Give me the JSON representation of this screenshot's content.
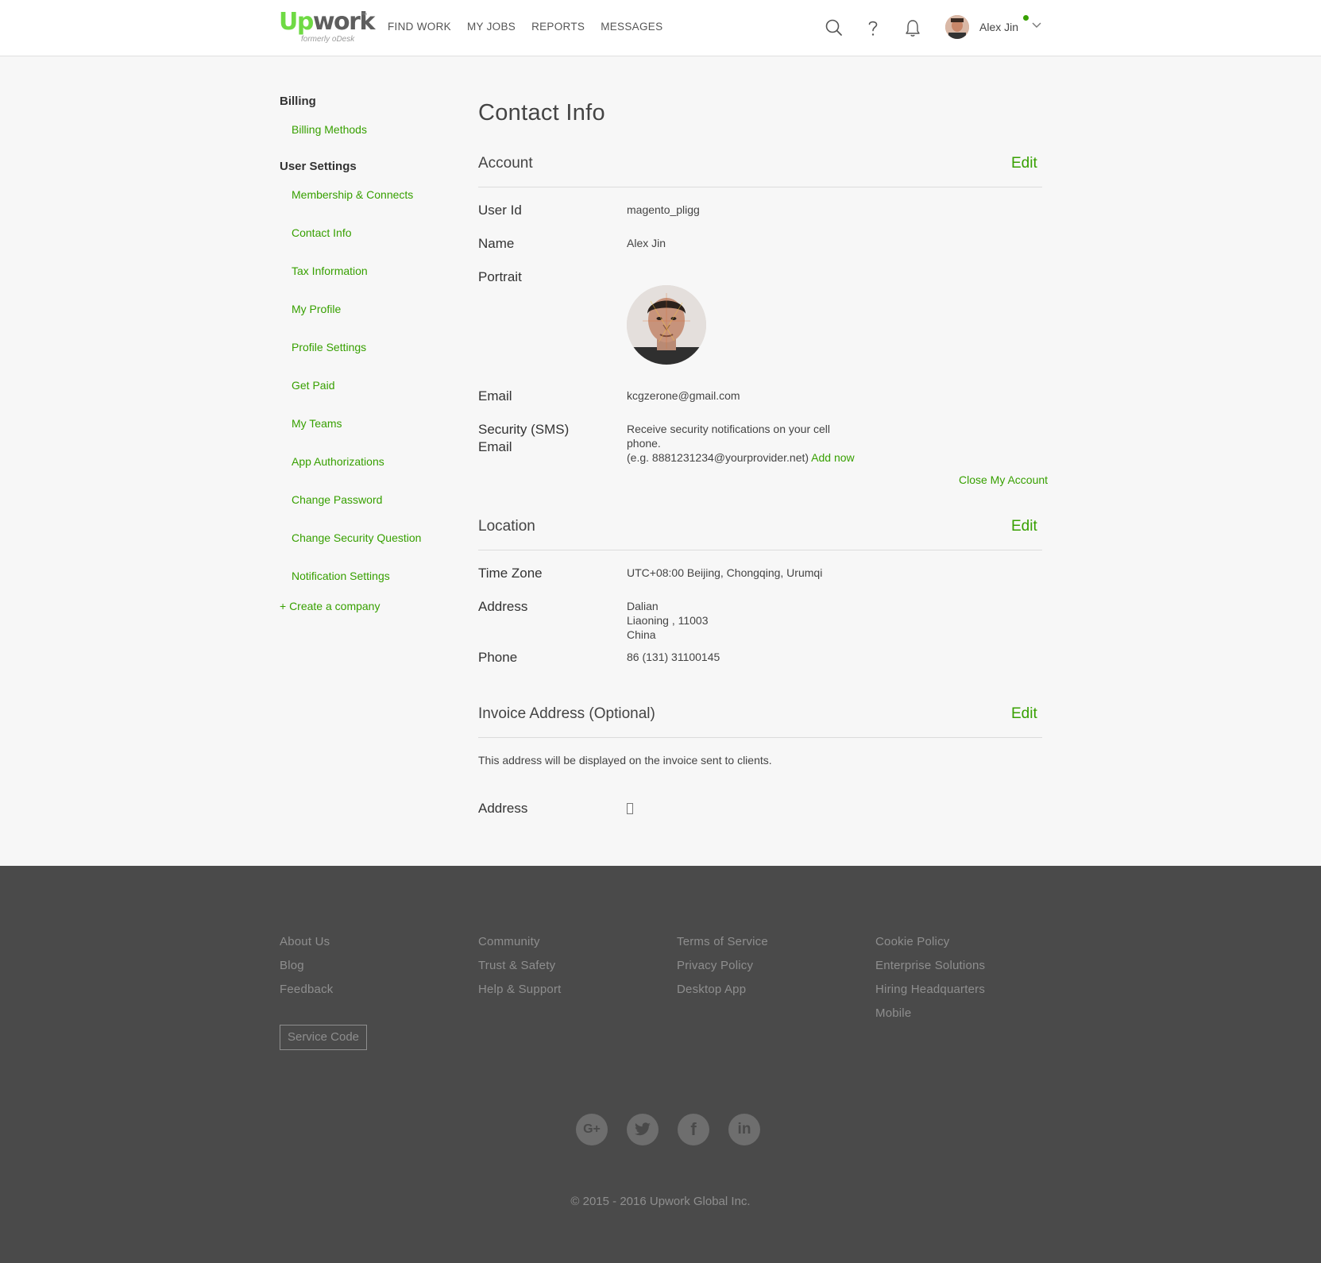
{
  "header": {
    "logo_text_green": "Up",
    "logo_text_gray": "work",
    "logo_tm": "™",
    "logo_sub": "formerly oDesk",
    "nav": [
      "FIND WORK",
      "MY JOBS",
      "REPORTS",
      "MESSAGES"
    ],
    "icons": [
      "search-icon",
      "help-icon",
      "bell-icon"
    ],
    "user_name": "Alex Jin",
    "status_color": "#37a000"
  },
  "sidebar": {
    "billing_heading": "Billing",
    "billing_items": [
      "Billing Methods"
    ],
    "user_settings_heading": "User Settings",
    "user_settings_items": [
      "Membership & Connects",
      "Contact Info",
      "Tax Information",
      "My Profile",
      "Profile Settings",
      "Get Paid",
      "My Teams",
      "App Authorizations",
      "Change Password",
      "Change Security Question",
      "Notification Settings"
    ],
    "create_company": "+ Create a company"
  },
  "main": {
    "title": "Contact Info",
    "account": {
      "title": "Account",
      "edit": "Edit",
      "user_id_label": "User Id",
      "user_id": "magento_pligg",
      "name_label": "Name",
      "name": "Alex Jin",
      "portrait_label": "Portrait",
      "email_label": "Email",
      "email": "kcgzerone@gmail.com",
      "sms_label_1": "Security (SMS)",
      "sms_label_2": "Email",
      "sms_line_1": "Receive security notifications on your cell",
      "sms_line_2": "phone.",
      "sms_line_3": "(e.g. 8881231234@yourprovider.net)",
      "add_now": "Add now",
      "close_account": "Close My Account"
    },
    "location": {
      "title": "Location",
      "edit": "Edit",
      "timezone_label": "Time Zone",
      "timezone": "UTC+08:00 Beijing, Chongqing, Urumqi",
      "address_label": "Address",
      "address_line_1": "Dalian",
      "address_line_2": "Liaoning , 11003",
      "address_line_3": "China",
      "phone_label": "Phone",
      "phone": "86 (131) 31100145"
    },
    "invoice": {
      "title": "Invoice Address (Optional)",
      "edit": "Edit",
      "note": "This address will be displayed on the invoice sent to clients.",
      "address_label": "Address"
    }
  },
  "footer": {
    "col1": [
      "About Us",
      "Blog",
      "Feedback"
    ],
    "col2": [
      "Community",
      "Trust & Safety",
      "Help & Support"
    ],
    "col3": [
      "Terms of Service",
      "Privacy Policy",
      "Desktop App"
    ],
    "col4": [
      "Cookie Policy",
      "Enterprise Solutions",
      "Hiring Headquarters",
      "Mobile"
    ],
    "service_code": "Service Code",
    "social": [
      "G+",
      "twitter-icon",
      "f",
      "in"
    ],
    "copyright": "© 2015 - 2016 Upwork Global Inc."
  },
  "colors": {
    "brand_green": "#37a000",
    "logo_green": "#6fda44",
    "footer_bg": "#4a4a4a",
    "page_bg": "#f7f7f7"
  }
}
